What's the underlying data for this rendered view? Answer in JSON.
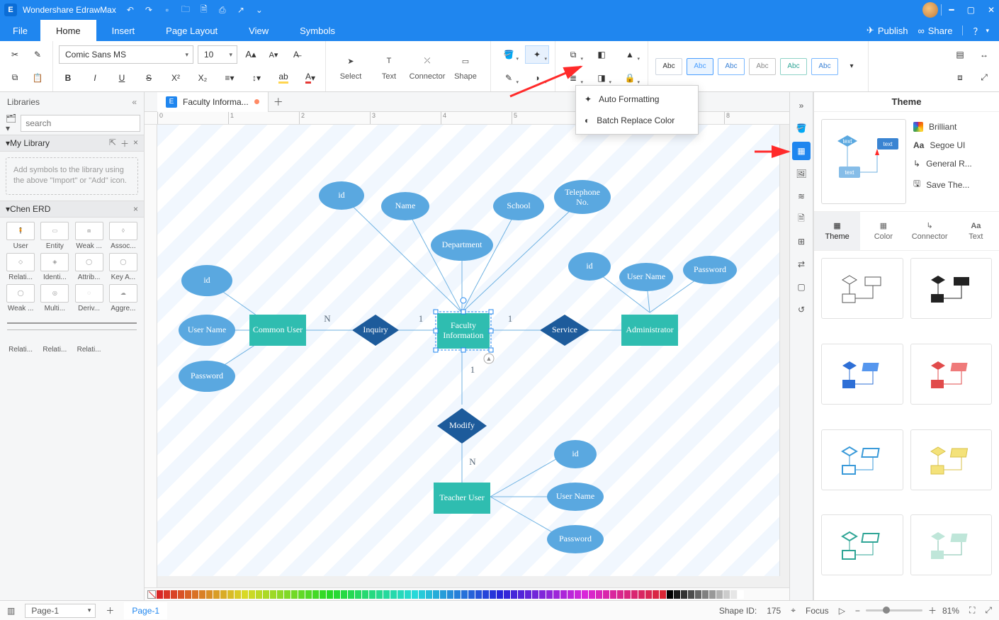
{
  "app": {
    "title": "Wondershare EdrawMax"
  },
  "menu": {
    "file": "File",
    "tabs": [
      "Home",
      "Insert",
      "Page Layout",
      "View",
      "Symbols"
    ],
    "active": "Home",
    "publish": "Publish",
    "share": "Share"
  },
  "ribbon": {
    "font_name": "Comic Sans MS",
    "font_size": "10",
    "select": "Select",
    "text": "Text",
    "connector": "Connector",
    "shape": "Shape",
    "styles": [
      "Abc",
      "Abc",
      "Abc",
      "Abc",
      "Abc",
      "Abc"
    ]
  },
  "dropdown": {
    "auto_formatting": "Auto Formatting",
    "batch_replace": "Batch Replace Color"
  },
  "left": {
    "libraries": "Libraries",
    "search_placeholder": "search",
    "my_library": "My Library",
    "dropzone": "Add symbols to the library using the above \"Import\" or \"Add\" icon.",
    "chen": "Chen ERD",
    "shapes_row1": [
      "User",
      "Entity",
      "Weak ...",
      "Assoc..."
    ],
    "shapes_row2": [
      "Relati...",
      "Identi...",
      "Attrib...",
      "Key A..."
    ],
    "shapes_row3": [
      "Weak ...",
      "Multi...",
      "Deriv...",
      "Aggre..."
    ],
    "shapes_row4": [
      "Relati...",
      "Relati...",
      "Relati..."
    ]
  },
  "doc": {
    "tab_title": "Faculty Informa..."
  },
  "erd": {
    "common_user_attrs": [
      "id",
      "User Name",
      "Password"
    ],
    "common_user": "Common User",
    "inquiry": "Inquiry",
    "faculty": "Faculty Information",
    "faculty_attrs": [
      "id",
      "Name",
      "School",
      "Telephone No.",
      "Department"
    ],
    "service": "Service",
    "administrator": "Administrator",
    "admin_attrs": [
      "id",
      "User Name",
      "Password"
    ],
    "modify": "Modify",
    "teacher": "Teacher User",
    "teacher_attrs": [
      "id",
      "User Name",
      "Password"
    ],
    "card_n": "N",
    "card_1": "1"
  },
  "theme": {
    "title": "Theme",
    "brilliant": "Brilliant",
    "font": "Segoe UI",
    "connector": "General R...",
    "save": "Save The...",
    "tabs": [
      "Theme",
      "Color",
      "Connector",
      "Text"
    ]
  },
  "status": {
    "page_select": "Page-1",
    "page_label": "Page-1",
    "shape_id_label": "Shape ID:",
    "shape_id": "175",
    "focus": "Focus",
    "zoom": "81%"
  },
  "colors": {
    "primary": "#1f86ef",
    "entity_teal": "#2fbdb0",
    "attr_blue": "#5aa8e0",
    "diamond_dark": "#1d5b9b"
  }
}
